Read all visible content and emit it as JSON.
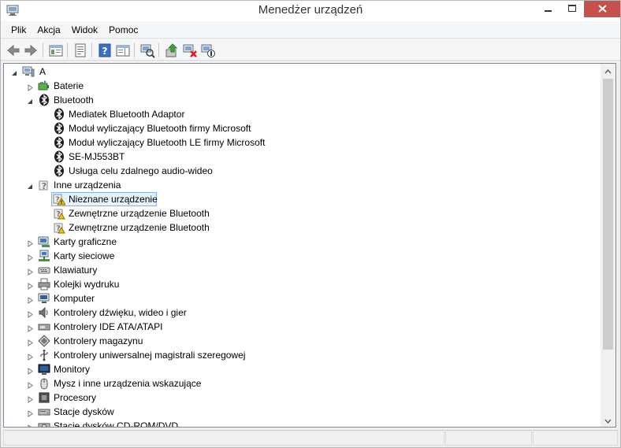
{
  "window": {
    "title": "Menedżer urządzeń"
  },
  "menu": [
    "Plik",
    "Akcja",
    "Widok",
    "Pomoc"
  ],
  "toolbar": {
    "buttons": [
      "back-icon",
      "forward-icon",
      "show-hide-console-tree-icon",
      "properties-icon",
      "help-icon",
      "show-hide-action-pane-icon",
      "scan-hardware-changes-icon",
      "update-driver-icon",
      "uninstall-device-icon",
      "disable-device-icon"
    ]
  },
  "tree": {
    "root": "A",
    "items": [
      {
        "label": "Baterie",
        "level": 1,
        "expanded": false,
        "icon": "battery-icon"
      },
      {
        "label": "Bluetooth",
        "level": 1,
        "expanded": true,
        "icon": "bluetooth-icon"
      },
      {
        "label": "Mediatek Bluetooth Adaptor",
        "level": 2,
        "icon": "bluetooth-icon"
      },
      {
        "label": "Moduł wyliczający Bluetooth firmy Microsoft",
        "level": 2,
        "icon": "bluetooth-icon"
      },
      {
        "label": "Moduł wyliczający Bluetooth LE firmy Microsoft",
        "level": 2,
        "icon": "bluetooth-icon"
      },
      {
        "label": "SE-MJ553BT",
        "level": 2,
        "icon": "bluetooth-icon"
      },
      {
        "label": "Usługa celu zdalnego audio-wideo",
        "level": 2,
        "icon": "bluetooth-icon"
      },
      {
        "label": "Inne urządzenia",
        "level": 1,
        "expanded": true,
        "icon": "unknown-device-icon"
      },
      {
        "label": "Nieznane urządzenie",
        "level": 2,
        "icon": "warning-device-icon",
        "selected": true
      },
      {
        "label": "Zewnętrzne urządzenie Bluetooth",
        "level": 2,
        "icon": "unknown-device-icon"
      },
      {
        "label": "Zewnętrzne urządzenie Bluetooth",
        "level": 2,
        "icon": "unknown-device-icon"
      },
      {
        "label": "Karty graficzne",
        "level": 1,
        "expanded": false,
        "icon": "display-adapter-icon"
      },
      {
        "label": "Karty sieciowe",
        "level": 1,
        "expanded": false,
        "icon": "network-adapter-icon"
      },
      {
        "label": "Klawiatury",
        "level": 1,
        "expanded": false,
        "icon": "keyboard-icon"
      },
      {
        "label": "Kolejki wydruku",
        "level": 1,
        "expanded": false,
        "icon": "printer-icon"
      },
      {
        "label": "Komputer",
        "level": 1,
        "expanded": false,
        "icon": "computer-icon"
      },
      {
        "label": "Kontrolery dźwięku, wideo i gier",
        "level": 1,
        "expanded": false,
        "icon": "sound-icon"
      },
      {
        "label": "Kontrolery IDE ATA/ATAPI",
        "level": 1,
        "expanded": false,
        "icon": "ide-controller-icon"
      },
      {
        "label": "Kontrolery magazynu",
        "level": 1,
        "expanded": false,
        "icon": "storage-controller-icon"
      },
      {
        "label": "Kontrolery uniwersalnej magistrali szeregowej",
        "level": 1,
        "expanded": false,
        "icon": "usb-icon"
      },
      {
        "label": "Monitory",
        "level": 1,
        "expanded": false,
        "icon": "monitor-icon"
      },
      {
        "label": "Mysz i inne urządzenia wskazujące",
        "level": 1,
        "expanded": false,
        "icon": "mouse-icon"
      },
      {
        "label": "Procesory",
        "level": 1,
        "expanded": false,
        "icon": "processor-icon"
      },
      {
        "label": "Stacje dysków",
        "level": 1,
        "expanded": false,
        "icon": "disk-drive-icon"
      },
      {
        "label": "Stacje dysków CD-ROM/DVD",
        "level": 1,
        "expanded": false,
        "icon": "dvd-drive-icon"
      }
    ]
  },
  "colors": {
    "close_button": "#c7504c",
    "selection_bg": "#e5f3fb",
    "selection_border": "#7eb4ea",
    "bluetooth_blue": "#1a1a1a"
  }
}
